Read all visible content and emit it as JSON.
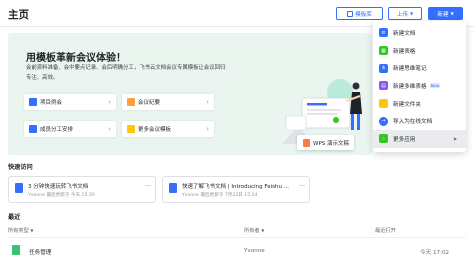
{
  "header": {
    "title": "主页",
    "template_btn": "模板库",
    "upload_btn": "上传",
    "new_btn": "新建"
  },
  "banner": {
    "title": "用模板革新会议体验！",
    "desc": "会前资料准备、会中要点记录、会后明确分工，飞书云文档会议专属模板让会议回归专注、高效。",
    "cards": [
      "项目例会",
      "会议纪要",
      "成员分工安排",
      "更多会议模板"
    ],
    "wps_label": "WPS 演示文稿"
  },
  "new_menu": {
    "items": [
      {
        "label": "新建文档",
        "icon": "doc-icon",
        "color": "#3370ff"
      },
      {
        "label": "新建表格",
        "icon": "sheet-icon",
        "color": "#34c724"
      },
      {
        "label": "新建思维笔记",
        "icon": "mindnote-icon",
        "color": "#3370ff"
      },
      {
        "label": "新建多维表格",
        "icon": "bitable-icon",
        "color": "#8d55ed",
        "badge": "Beta"
      },
      {
        "label": "新建文件夹",
        "icon": "folder-icon",
        "color": "#ffc60a"
      },
      {
        "label": "导入为在线文档",
        "icon": "import-icon",
        "color": "#3370ff"
      },
      {
        "label": "更多应用",
        "icon": "apps-icon",
        "color": "#34c724"
      }
    ]
  },
  "quick_access": {
    "title": "快速访问",
    "items": [
      {
        "title": "3 分钟快速玩转飞书文档",
        "meta": "Yvonne 最后更新于 今天 15:30"
      },
      {
        "title": "快速了解飞书文档 | Introducing Feishu ...",
        "meta": "Yvonne 最后更新于 7月22日 15:24"
      }
    ]
  },
  "recent": {
    "title": "最近",
    "columns": [
      "所有类型",
      "所有者",
      "最近打开"
    ],
    "rows": [
      {
        "name": "任务管理",
        "owner": "Yvonne",
        "time": "今天 17:02"
      }
    ]
  },
  "colors": {
    "accent": "#3370ff",
    "banner_bg": "#eaf5f0"
  }
}
